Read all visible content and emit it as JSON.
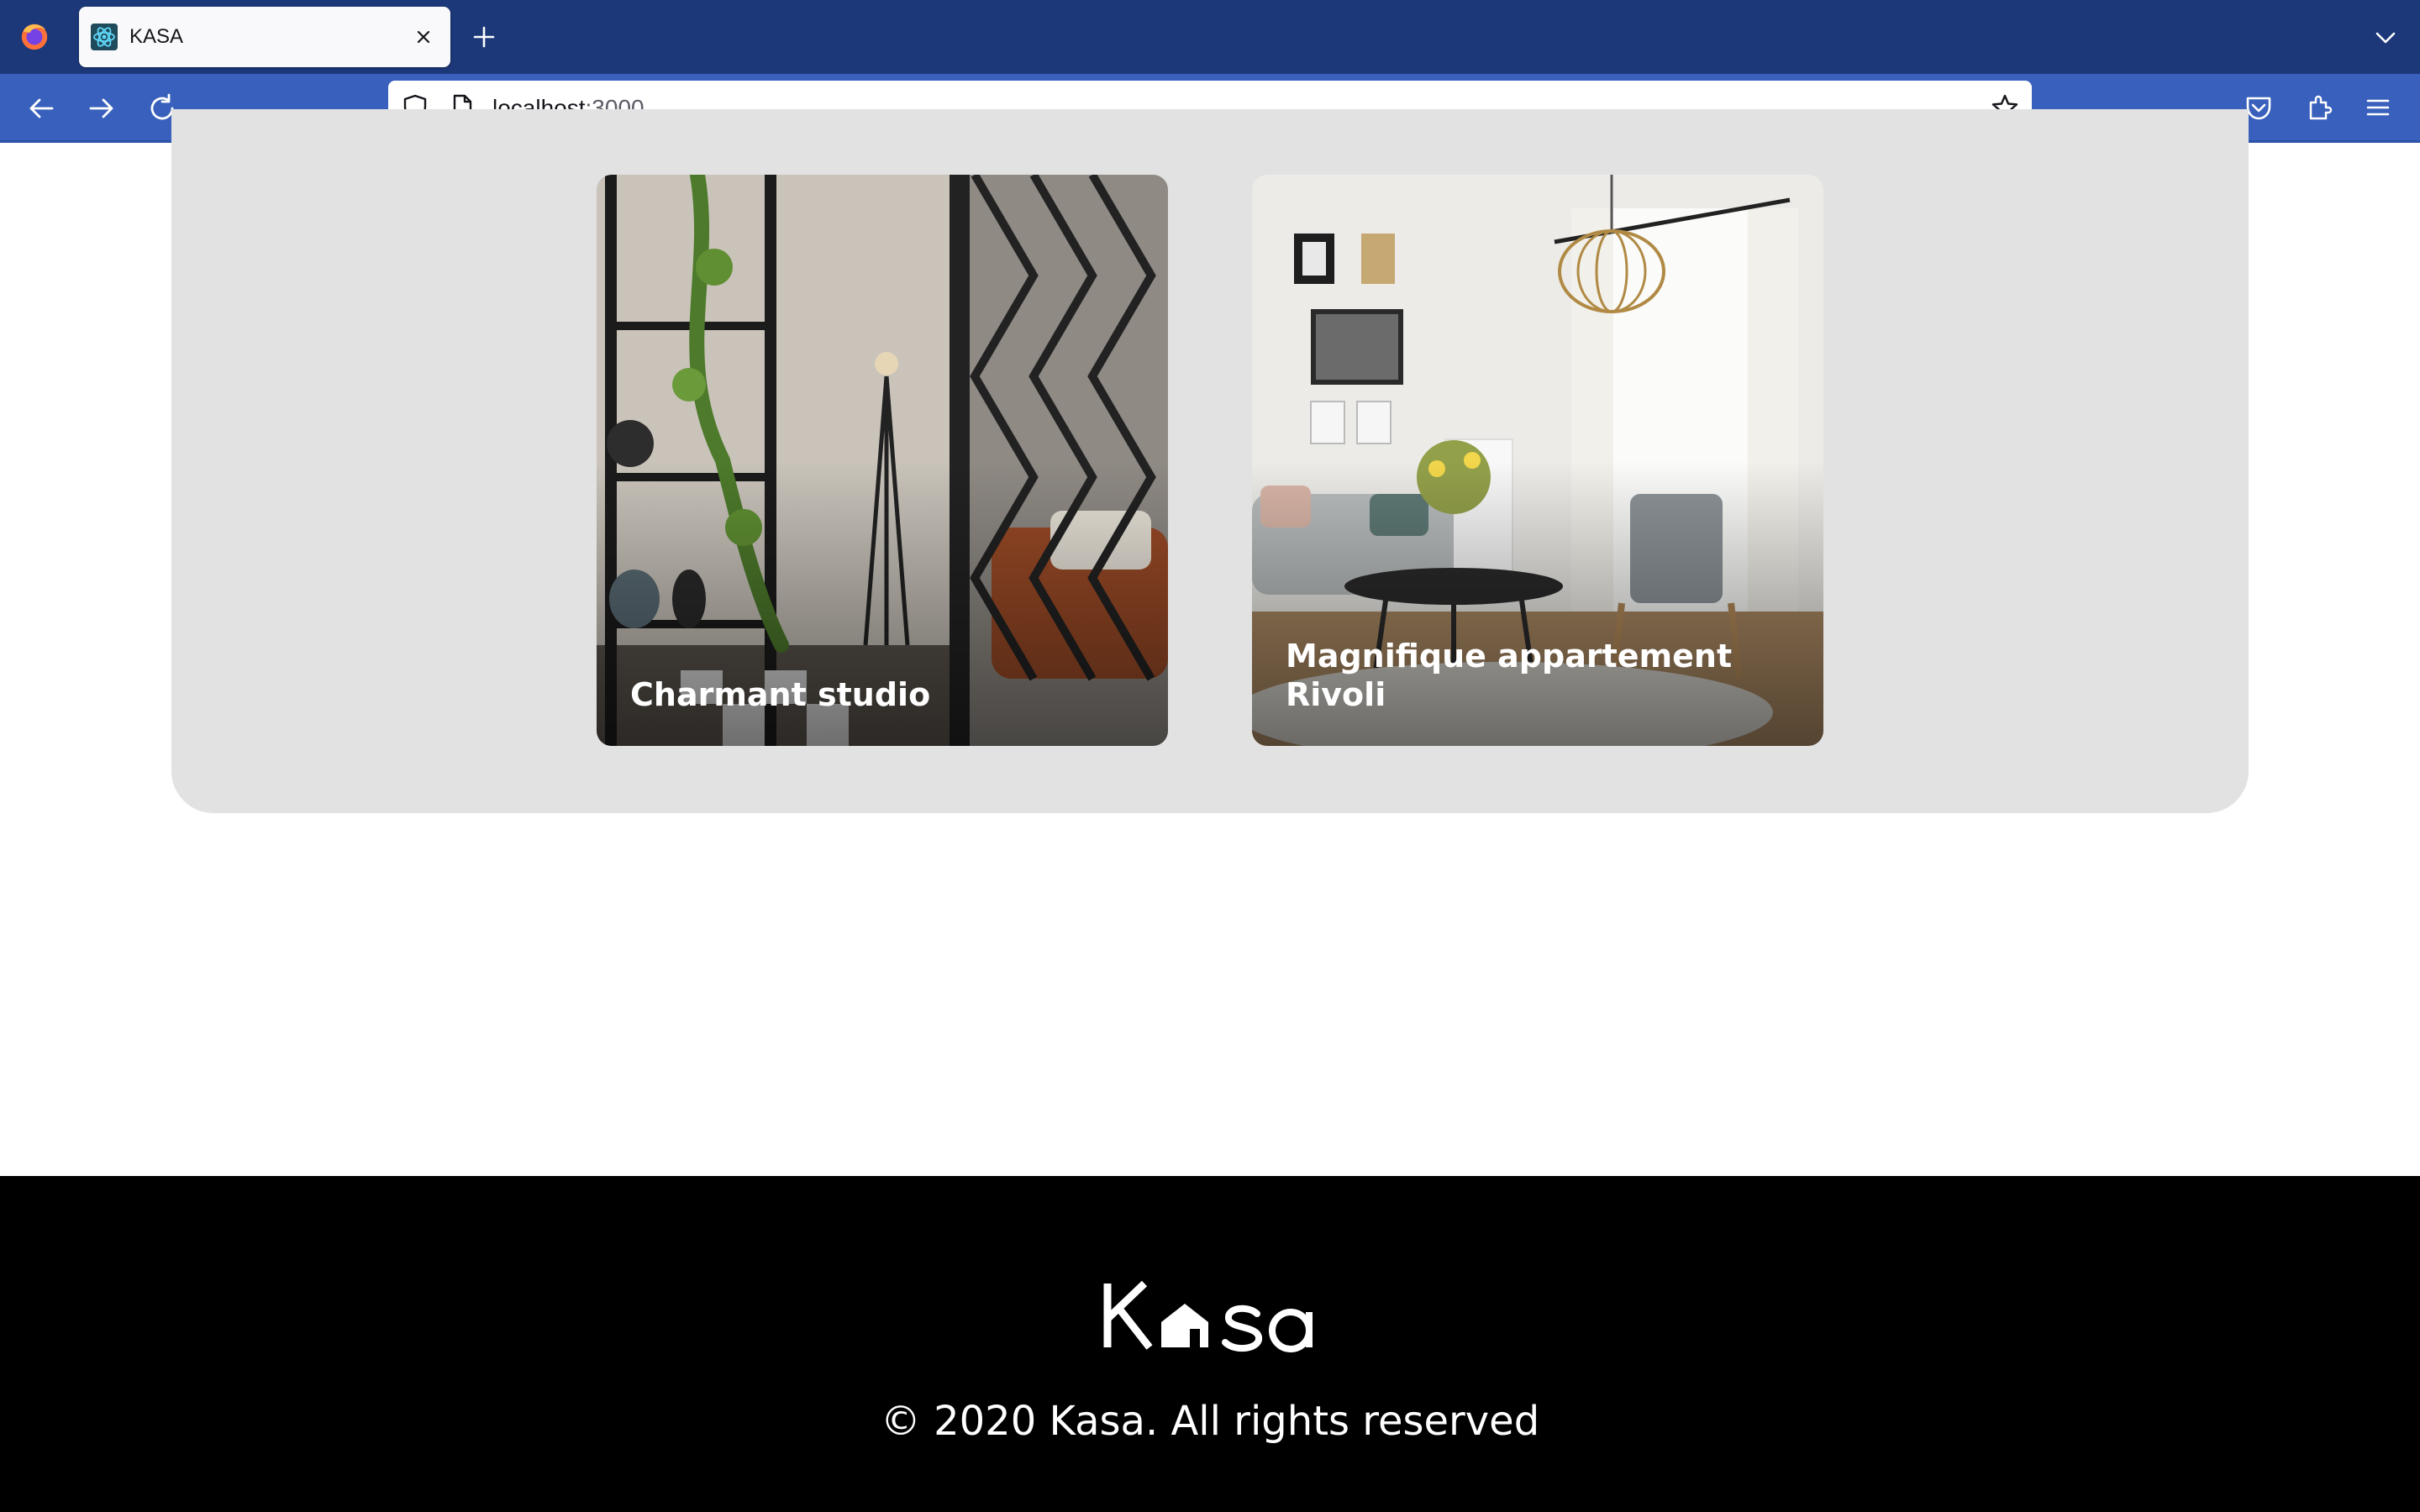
{
  "browser": {
    "tab": {
      "title": "KASA",
      "favicon": "react-atom-icon"
    },
    "url": {
      "host": "localhost",
      "port": ":3000"
    },
    "icons": [
      "firefox-logo",
      "close-icon",
      "plus-icon",
      "chevron-down-icon",
      "back-arrow-icon",
      "forward-arrow-icon",
      "reload-icon",
      "shield-icon",
      "page-icon",
      "star-icon",
      "pocket-icon",
      "extensions-icon",
      "menu-icon"
    ]
  },
  "listings": [
    {
      "title": "Charmant studio"
    },
    {
      "title": "Magnifique appartement Rivoli"
    }
  ],
  "footer": {
    "logo": "Kasa",
    "copyright": "© 2020 Kasa. All rights reserved"
  },
  "colors": {
    "tabbar": "#1c3879",
    "navbar": "#3960bc",
    "gallery_bg": "#e2e2e2",
    "footer_bg": "#000000"
  }
}
